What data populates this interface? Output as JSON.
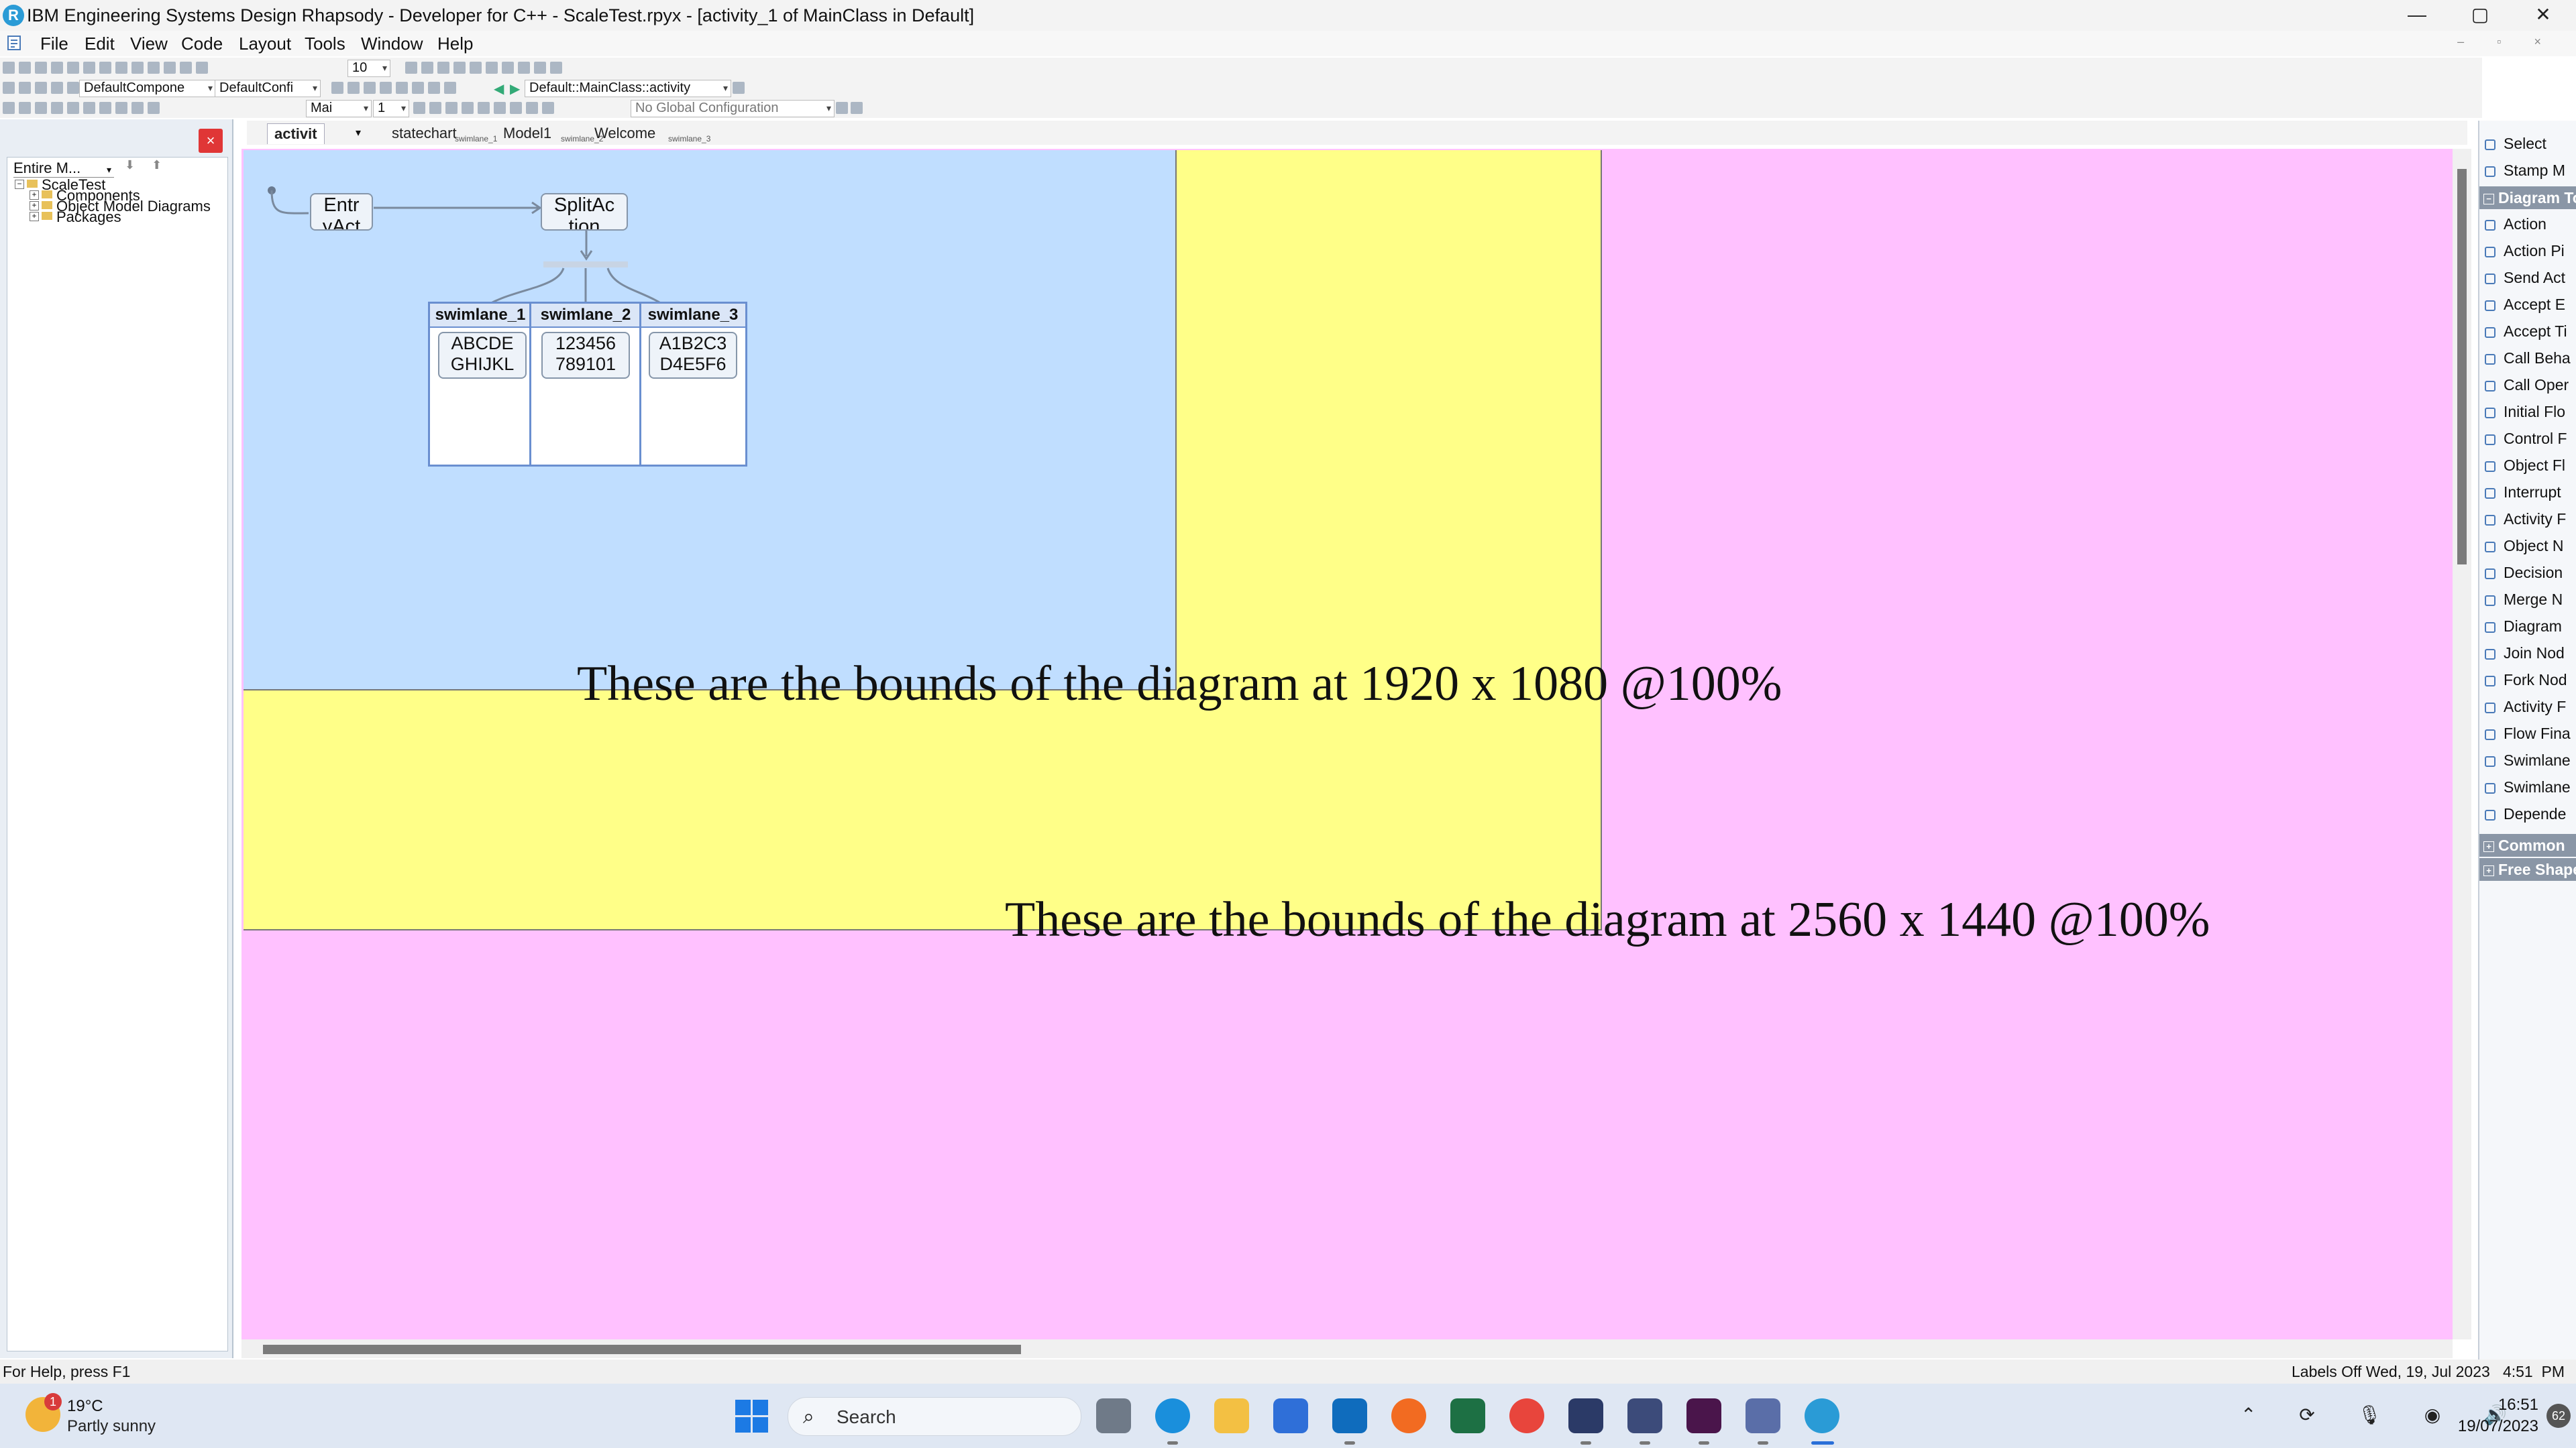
{
  "window": {
    "title": "IBM Engineering Systems Design Rhapsody - Developer for C++ - ScaleTest.rpyx - [activity_1 of MainClass in Default]",
    "logo_glyph": "R",
    "controls": {
      "minimize": "—",
      "maximize": "▢",
      "close": "✕"
    }
  },
  "menu": {
    "items": [
      "File",
      "Edit",
      "View",
      "Code",
      "Layout",
      "Tools",
      "Window",
      "Help"
    ],
    "mdi_controls": "– ▫ ×"
  },
  "toolbar": {
    "zoom_value": "10",
    "component_select": "DefaultCompone",
    "config_select": "DefaultConfi",
    "diagram_path": "Default::MainClass::activity",
    "font_select": "Mai",
    "size_select": "1",
    "global_config": "No Global Configuration"
  },
  "browser": {
    "filter": "Entire M...",
    "nav_glyphs": "⬇ ⬆",
    "close_glyph": "×",
    "tree": [
      {
        "label": "ScaleTest",
        "level": 0
      },
      {
        "label": "Components",
        "level": 1
      },
      {
        "label": "Object Model Diagrams",
        "level": 1
      },
      {
        "label": "Packages",
        "level": 1
      }
    ]
  },
  "tabs": [
    "activit",
    "statechart",
    "Model1",
    "Welcome"
  ],
  "tab_mini_labels": [
    "swimlane_1",
    "swimlane_2",
    "swimlane_3"
  ],
  "diagram": {
    "entry_action": "Entr\nyAct",
    "split_action": "SplitAc\ntion",
    "swimlanes": [
      {
        "name": "swimlane_1",
        "action_line1": "ABCDE",
        "action_line2": "GHIJKL"
      },
      {
        "name": "swimlane_2",
        "action_line1": "123456",
        "action_line2": "789101"
      },
      {
        "name": "swimlane_3",
        "action_line1": "A1B2C3",
        "action_line2": "D4E5F6"
      }
    ],
    "label_1080": "These are the bounds of the diagram at 1920 x 1080 @100%",
    "label_1440": "These are the bounds of the diagram at 2560 x 1440 @100%",
    "colors": {
      "canvas": "#ffc1ff",
      "region_2560": "#ffff88",
      "region_1920": "#c0deff"
    }
  },
  "toolbox": {
    "items": [
      "Select",
      "Stamp M",
      "Action",
      "Action Pi",
      "Send Act",
      "Accept E",
      "Accept Ti",
      "Call Beha",
      "Call Oper",
      "Initial Flo",
      "Control F",
      "Object Fl",
      "Interrupt",
      "Activity F",
      "Object N",
      "Decision",
      "Merge N",
      "Diagram",
      "Join Nod",
      "Fork Nod",
      "Activity F",
      "Flow Fina",
      "Swimlane",
      "Swimlane",
      "Depende"
    ],
    "group_diagram": "Diagram To",
    "group_common": "Common",
    "group_free": "Free Shape"
  },
  "status": {
    "help": "For Help, press F1",
    "right": "Labels Off Wed, 19, Jul 2023   4:51  PM"
  },
  "taskbar": {
    "weather_temp": "19°C",
    "weather_desc": "Partly sunny",
    "weather_badge": "1",
    "search_label": "Search",
    "search_glyph": "⌕",
    "tray_glyphs": "⌃ ⟳ 🎙 ◉ 🔊 ▭",
    "time": "16:51",
    "date": "19/07/2023",
    "notifications": "62",
    "apps": [
      "task-view",
      "edge",
      "file-explorer",
      "store",
      "outlook",
      "firefox",
      "excel",
      "chrome",
      "app-w",
      "app-code",
      "slack",
      "app-installer",
      "rhapsody"
    ]
  }
}
